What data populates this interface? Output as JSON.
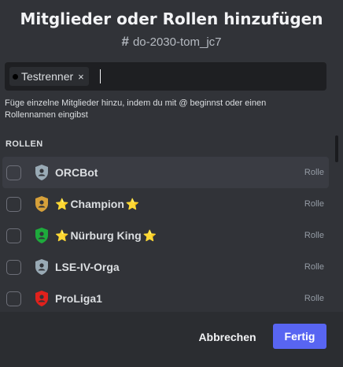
{
  "modal": {
    "title": "Mitglieder oder Rollen hinzufügen",
    "channel": "do-2030-tom_jc7",
    "channel_icon": "hash-icon"
  },
  "search": {
    "chip_label": "Testrenner",
    "chip_remove": "×",
    "value": ""
  },
  "hint": "Füge einzelne Mitglieder hinzu, indem du mit @ beginnst oder einen Rollennamen eingibst",
  "section": {
    "roles_header": "ROLLEN"
  },
  "roles": [
    {
      "name": "ORCBot",
      "type": "Rolle",
      "color": "#99aab5",
      "stars": false,
      "icon": "shield-icon",
      "checked": false
    },
    {
      "name": "Champion",
      "type": "Rolle",
      "color": "#d6a03a",
      "stars": true,
      "icon": "shield-icon",
      "checked": false
    },
    {
      "name": "Nürburg King",
      "type": "Rolle",
      "color": "#1eaa3c",
      "stars": true,
      "icon": "shield-icon",
      "checked": false
    },
    {
      "name": "LSE-IV-Orga",
      "type": "Rolle",
      "color": "#99aab5",
      "stars": false,
      "icon": "shield-icon",
      "checked": false
    },
    {
      "name": "ProLiga1",
      "type": "Rolle",
      "color": "#e0211c",
      "stars": false,
      "icon": "shield-icon",
      "checked": false
    }
  ],
  "footer": {
    "cancel_label": "Abbrechen",
    "done_label": "Fertig"
  },
  "colors": {
    "accent": "#5865f2",
    "star": "#f9c22e"
  }
}
